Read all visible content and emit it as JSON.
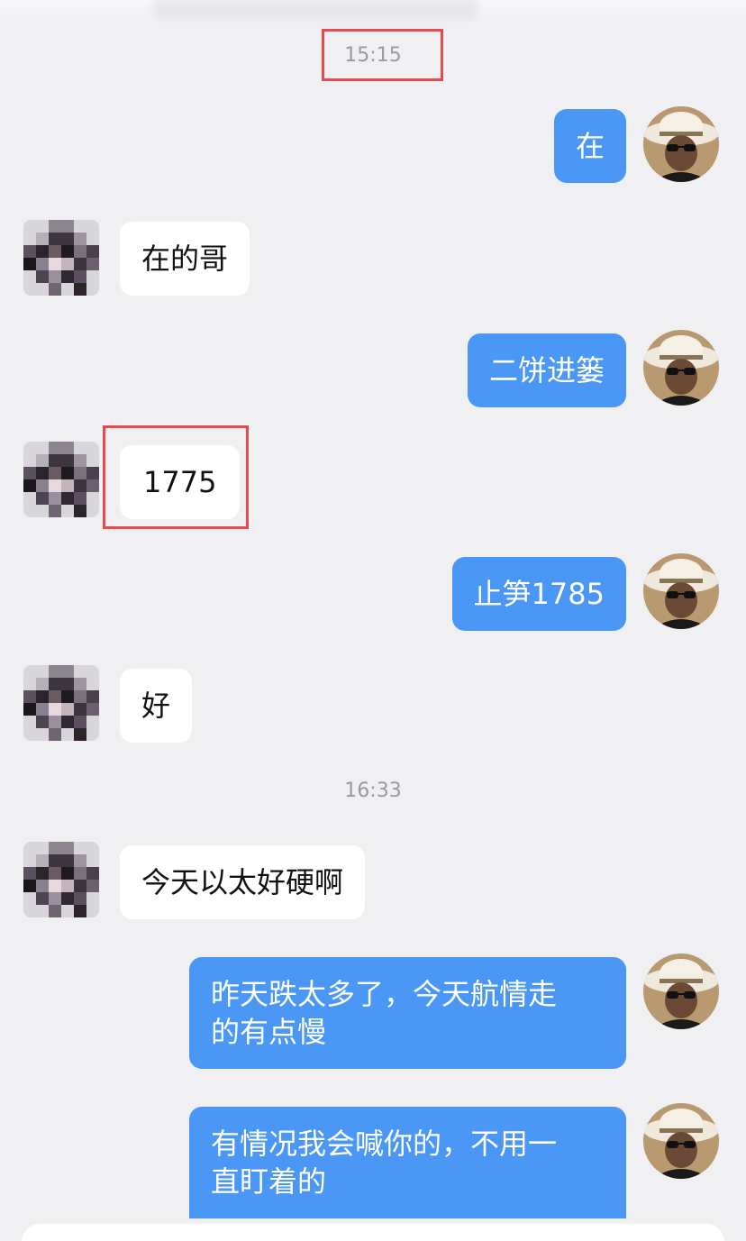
{
  "timestamps": [
    "15:15",
    "16:33"
  ],
  "messages": [
    {
      "side": "me",
      "text": "在"
    },
    {
      "side": "other",
      "text": "在的哥"
    },
    {
      "side": "me",
      "text": "二饼进篓"
    },
    {
      "side": "other",
      "text": "1775"
    },
    {
      "side": "me",
      "text": "止笋1785"
    },
    {
      "side": "other",
      "text": "好"
    },
    {
      "side": "other",
      "text": "今天以太好硬啊"
    },
    {
      "side": "me",
      "text": "昨天跌太多了，今天航情走\n的有点慢"
    },
    {
      "side": "me",
      "text": "有情况我会喊你的，不用一\n直盯着的"
    }
  ],
  "colors": {
    "self_bubble": "#4a97f5",
    "other_bubble": "#ffffff",
    "highlight": "#e8494e",
    "background": "#f0f0f2"
  },
  "icons": {
    "self_avatar": "man-in-white-hat-avatar-icon",
    "other_avatar": "pixelated-avatar-icon"
  }
}
